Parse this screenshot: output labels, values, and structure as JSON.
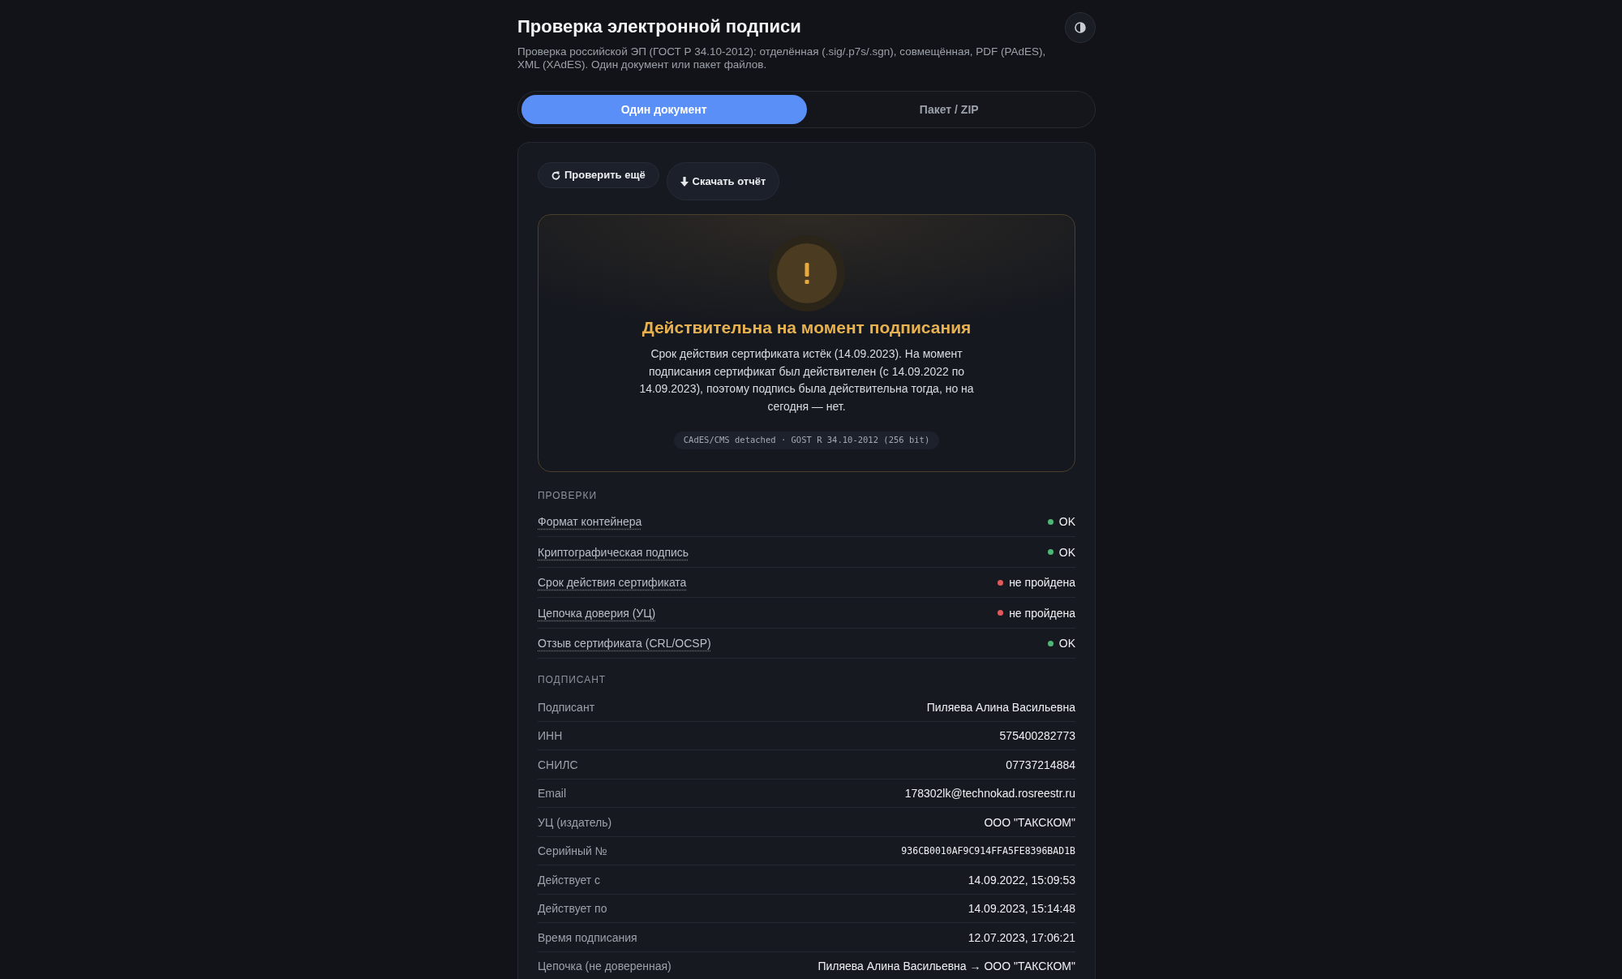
{
  "header": {
    "title": "Проверка электронной подписи",
    "subtitle": "Проверка российской ЭП (ГОСТ Р 34.10-2012): отделённая (.sig/.p7s/.sgn), совмещённая, PDF (PAdES), XML (XAdES). Один документ или пакет файлов."
  },
  "tabs": [
    {
      "label": "Один документ",
      "selected": true
    },
    {
      "label": "Пакет / ZIP",
      "selected": false
    }
  ],
  "actions": [
    {
      "kind": "refresh",
      "label": "Проверить ещё"
    },
    {
      "kind": "download",
      "label": "Скачать отчёт"
    }
  ],
  "result": {
    "kind": "warning",
    "title": "Действительна на момент подписания",
    "message": "Срок действия сертификата истёк (14.09.2023). На момент подписания сертификат был действителен (с 14.09.2022 по 14.09.2023), поэтому подпись была действительна тогда, но на сегодня — нет.",
    "format": "CAdES/CMS detached · GOST R 34.10-2012 (256 bit)"
  },
  "checks": {
    "heading": "ПРОВЕРКИ",
    "items": [
      {
        "label": "Формат контейнера",
        "color": "#4fb776",
        "result": "OK"
      },
      {
        "label": "Криптографическая подпись",
        "color": "#4fb776",
        "result": "OK"
      },
      {
        "label": "Срок действия сертификата",
        "color": "#e05a5a",
        "result": "не пройдена"
      },
      {
        "label": "Цепочка доверия (УЦ)",
        "color": "#e05a5a",
        "result": "не пройдена"
      },
      {
        "label": "Отзыв сертификата (CRL/OCSP)",
        "color": "#4fb776",
        "result": "OK"
      }
    ]
  },
  "signer": {
    "heading": "ПОДПИСАНТ",
    "rows": [
      {
        "kind": "text",
        "label": "Подписант",
        "value": "Пиляева Алина Васильевна"
      },
      {
        "kind": "text",
        "label": "ИНН",
        "value": "575400282773"
      },
      {
        "kind": "text",
        "label": "СНИЛС",
        "value": "07737214884"
      },
      {
        "kind": "text",
        "label": "Email",
        "value": "178302lk@technokad.rosreestr.ru"
      },
      {
        "kind": "text",
        "label": "УЦ (издатель)",
        "value": "ООО \"ТАКСКОМ\""
      },
      {
        "kind": "code",
        "label": "Серийный №",
        "value": "936CB0010AF9C914FFA5FE8396BAD1B"
      },
      {
        "kind": "text",
        "label": "Действует с",
        "value": "14.09.2022, 15:09:53"
      },
      {
        "kind": "text",
        "label": "Действует по",
        "value": "14.09.2023, 15:14:48"
      },
      {
        "kind": "text",
        "label": "Время подписания",
        "value": "12.07.2023, 17:06:21"
      },
      {
        "kind": "text",
        "label": "Цепочка (не доверенная)",
        "value": "Пиляева Алина Васильевна → ООО \"ТАКСКОМ\""
      }
    ]
  }
}
